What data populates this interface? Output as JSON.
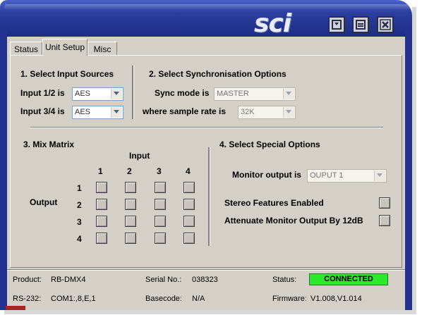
{
  "window": {
    "logo_text": "sci",
    "buttons": [
      {
        "name": "minimize-button",
        "icon": "tray-icon"
      },
      {
        "name": "restore-button",
        "icon": "restore-icon"
      },
      {
        "name": "close-button",
        "icon": "close-icon"
      }
    ]
  },
  "tabs": [
    {
      "label": "Status",
      "active": false
    },
    {
      "label": "Unit Setup",
      "active": true
    },
    {
      "label": "Misc",
      "active": false
    }
  ],
  "input_sources": {
    "title": "1. Select Input Sources",
    "rows": [
      {
        "label": "Input 1/2 is",
        "value": "AES"
      },
      {
        "label": "Input 3/4 is",
        "value": "AES"
      }
    ]
  },
  "sync": {
    "title": "2. Select Synchronisation Options",
    "rows": [
      {
        "label": "Sync mode is",
        "value": "MASTER"
      },
      {
        "label": "where sample rate is",
        "value": "32K"
      }
    ]
  },
  "mix_matrix": {
    "title": "3. Mix Matrix",
    "input_label": "Input",
    "output_label": "Output",
    "columns": [
      "1",
      "2",
      "3",
      "4"
    ],
    "rows": [
      "1",
      "2",
      "3",
      "4"
    ]
  },
  "special": {
    "title": "4. Select Special  Options",
    "monitor_label": "Monitor output is",
    "monitor_value": "OUPUT 1",
    "stereo_label": "Stereo Features Enabled",
    "attenuate_label": "Attenuate Monitor Output By 12dB"
  },
  "statusbar": {
    "product_label": "Product:",
    "product_value": "RB-DMX4",
    "serial_label": "Serial No.:",
    "serial_value": "038323",
    "status_label": "Status:",
    "status_value": "CONNECTED",
    "status_color": "#2ee82e",
    "rs232_label": "RS-232:",
    "rs232_value": "COM1:,8,E,1",
    "basecode_label": "Basecode:",
    "basecode_value": "N/A",
    "firmware_label": "Firmware:",
    "firmware_value": "V1.008,V1.014"
  }
}
